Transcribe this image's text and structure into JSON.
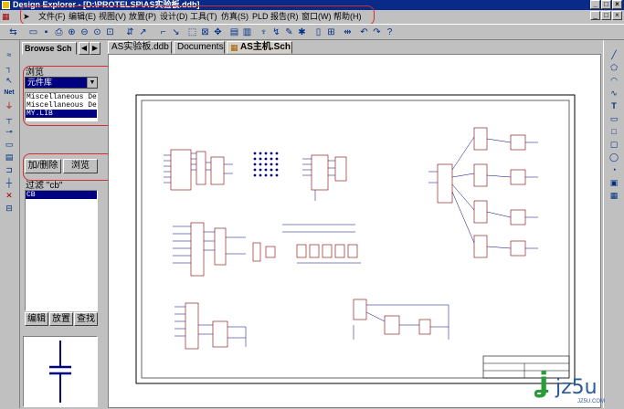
{
  "window": {
    "title": "Design Explorer - [D:\\PROTELSP\\AS实验板.ddb]"
  },
  "menu": [
    "文件(F)",
    "编辑(E)",
    "视图(V)",
    "放置(P)",
    "设计(D)",
    "工具(T)",
    "仿真(S)",
    "PLD",
    "报告(R)",
    "窗口(W)",
    "帮助(H)"
  ],
  "panel": {
    "tab_label": "Browse Sch",
    "browse_label": "浏览",
    "library_select": "元件库",
    "libraries": [
      "Miscellaneous De",
      "Miscellaneous De",
      "MY.LIB"
    ],
    "add_remove_button": "加/删除",
    "browse_button": "浏览",
    "filter_label": "过滤 \"cb\"",
    "components": [
      "CB"
    ],
    "edit_button": "编辑",
    "place_button": "放置",
    "find_button": "查找"
  },
  "document_tabs": [
    "AS实验板.ddb",
    "Documents",
    "AS主机.Sch"
  ],
  "watermark": {
    "brand": "jz5u",
    "sub": "JZ5U.COM"
  },
  "colors": {
    "titlebar": "#0a2a8a",
    "selection": "#000080",
    "highlight": "#d03030"
  }
}
